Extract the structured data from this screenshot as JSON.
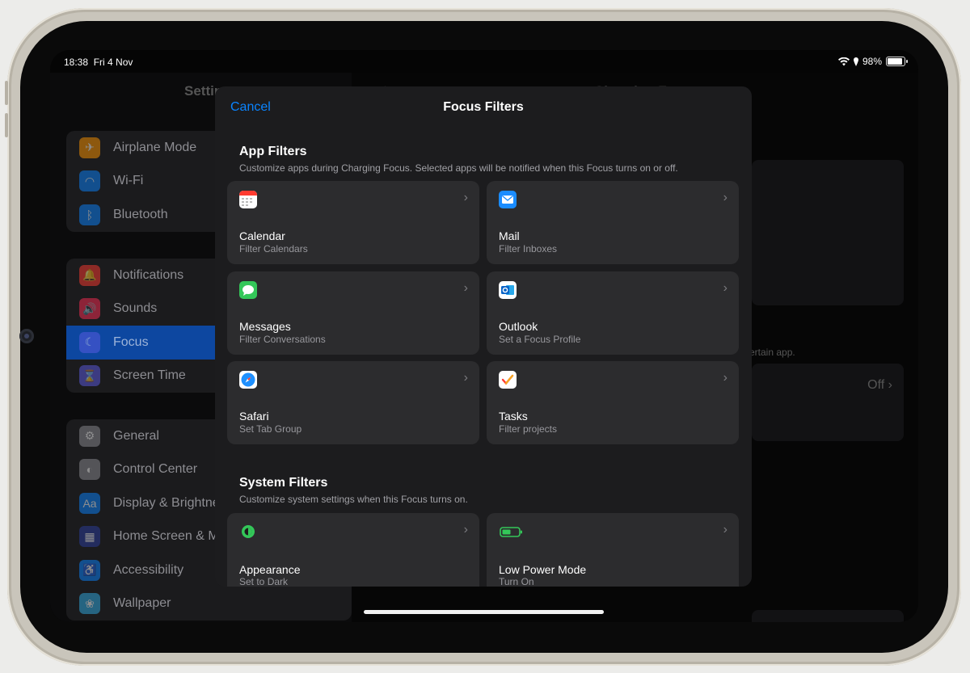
{
  "status_bar": {
    "time": "18:38",
    "date": "Fri 4 Nov",
    "battery": "98%"
  },
  "sidebar": {
    "title": "Settin",
    "groups": [
      [
        {
          "label": "Airplane Mode",
          "icon": "airplane-icon",
          "color": "#ff9500"
        },
        {
          "label": "Wi-Fi",
          "icon": "wifi-icon",
          "color": "#0a84ff"
        },
        {
          "label": "Bluetooth",
          "icon": "bluetooth-icon",
          "color": "#0a84ff"
        }
      ],
      [
        {
          "label": "Notifications",
          "icon": "bell-icon",
          "color": "#ff3b30"
        },
        {
          "label": "Sounds",
          "icon": "speaker-icon",
          "color": "#ff2d55"
        },
        {
          "label": "Focus",
          "icon": "moon-icon",
          "color": "#5e5ce6"
        },
        {
          "label": "Screen Time",
          "icon": "hourglass-icon",
          "color": "#5e5ce6"
        }
      ],
      [
        {
          "label": "General",
          "icon": "gear-icon",
          "color": "#8e8e93"
        },
        {
          "label": "Control Center",
          "icon": "switches-icon",
          "color": "#8e8e93"
        },
        {
          "label": "Display & Brightne",
          "icon": "text-size-icon",
          "color": "#0a84ff"
        },
        {
          "label": "Home Screen & M",
          "icon": "grid-icon",
          "color": "#2c3e9e"
        },
        {
          "label": "Accessibility",
          "icon": "accessibility-icon",
          "color": "#0a84ff"
        },
        {
          "label": "Wallpaper",
          "icon": "flower-icon",
          "color": "#32ade6"
        }
      ]
    ]
  },
  "detail": {
    "back_label": "<",
    "title": "Charging Focus",
    "hint_text": "ertain app.",
    "off_label": "Off"
  },
  "modal": {
    "cancel_label": "Cancel",
    "title": "Focus Filters",
    "app_filters": {
      "title": "App Filters",
      "description": "Customize apps during Charging Focus. Selected apps will be notified when this Focus turns on or off.",
      "items": [
        {
          "name": "Calendar",
          "subtitle": "Filter Calendars",
          "icon": "calendar-icon"
        },
        {
          "name": "Mail",
          "subtitle": "Filter Inboxes",
          "icon": "mail-icon"
        },
        {
          "name": "Messages",
          "subtitle": "Filter Conversations",
          "icon": "messages-icon"
        },
        {
          "name": "Outlook",
          "subtitle": "Set a Focus Profile",
          "icon": "outlook-icon"
        },
        {
          "name": "Safari",
          "subtitle": "Set Tab Group",
          "icon": "safari-icon"
        },
        {
          "name": "Tasks",
          "subtitle": "Filter projects",
          "icon": "tasks-icon"
        }
      ]
    },
    "system_filters": {
      "title": "System Filters",
      "description": "Customize system settings when this Focus turns on.",
      "items": [
        {
          "name": "Appearance",
          "subtitle": "Set to Dark",
          "icon": "appearance-icon"
        },
        {
          "name": "Low Power Mode",
          "subtitle": "Turn On",
          "icon": "battery-icon"
        }
      ]
    }
  }
}
